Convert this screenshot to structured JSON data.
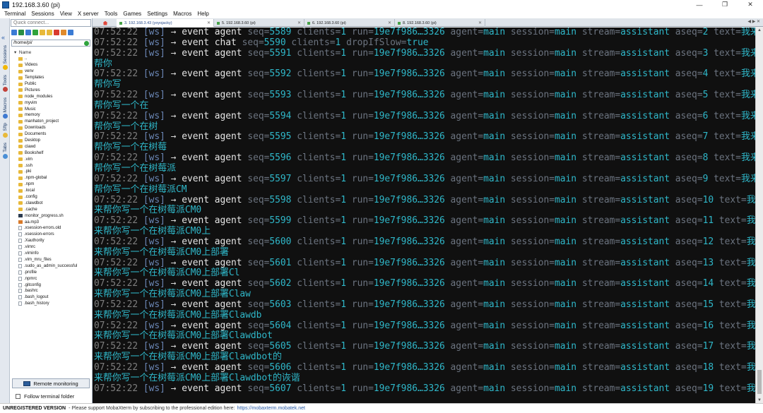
{
  "window": {
    "title": "192.168.3.60 (pi)",
    "controls": {
      "minimize": "—",
      "restore": "❐",
      "close": "✕"
    }
  },
  "menu": [
    "Terminal",
    "Sessions",
    "View",
    "X server",
    "Tools",
    "Games",
    "Settings",
    "Macros",
    "Help"
  ],
  "sidebar": {
    "collapse": "«",
    "tabs": [
      "Sessions",
      "Tools",
      "Macros",
      "Sftp",
      "Tabs"
    ]
  },
  "file_panel": {
    "quick_connect_placeholder": "Quick connect...",
    "path": "/home/pi/",
    "column_header": "Name",
    "files": [
      {
        "name": "..",
        "type": "updir"
      },
      {
        "name": "Videos",
        "type": "folder"
      },
      {
        "name": "venv",
        "type": "folder"
      },
      {
        "name": "Templates",
        "type": "folder"
      },
      {
        "name": "Public",
        "type": "folder"
      },
      {
        "name": "Pictures",
        "type": "folder"
      },
      {
        "name": "node_modules",
        "type": "folder"
      },
      {
        "name": "myvim",
        "type": "folder"
      },
      {
        "name": "Music",
        "type": "folder"
      },
      {
        "name": "memory",
        "type": "folder"
      },
      {
        "name": "manhaton_project",
        "type": "folder"
      },
      {
        "name": "Downloads",
        "type": "folder"
      },
      {
        "name": "Documents",
        "type": "folder"
      },
      {
        "name": "Desktop",
        "type": "folder"
      },
      {
        "name": "clawd",
        "type": "folder"
      },
      {
        "name": "Bookshelf",
        "type": "folder"
      },
      {
        "name": ".vim",
        "type": "folder"
      },
      {
        "name": ".ssh",
        "type": "folder"
      },
      {
        "name": ".pki",
        "type": "folder"
      },
      {
        "name": ".npm-global",
        "type": "folder"
      },
      {
        "name": ".npm",
        "type": "folder"
      },
      {
        "name": ".local",
        "type": "folder"
      },
      {
        "name": ".config",
        "type": "folder"
      },
      {
        "name": ".clawdbot",
        "type": "folder"
      },
      {
        "name": ".cache",
        "type": "folder"
      },
      {
        "name": "monitor_progress.sh",
        "type": "sh"
      },
      {
        "name": "aa.mp3",
        "type": "media"
      },
      {
        "name": ".xsession-errors.old",
        "type": "file"
      },
      {
        "name": ".xsession-errors",
        "type": "file"
      },
      {
        "name": ".Xauthority",
        "type": "file"
      },
      {
        "name": ".vimrc",
        "type": "file"
      },
      {
        "name": ".viminfo",
        "type": "file"
      },
      {
        "name": ".vim_mru_files",
        "type": "file"
      },
      {
        "name": ".sudo_as_admin_successful",
        "type": "file"
      },
      {
        "name": ".profile",
        "type": "file"
      },
      {
        "name": ".npmrc",
        "type": "file"
      },
      {
        "name": ".gitconfig",
        "type": "file"
      },
      {
        "name": ".bashrc",
        "type": "file"
      },
      {
        "name": ".bash_logout",
        "type": "file"
      },
      {
        "name": ".bash_history",
        "type": "file"
      }
    ],
    "remote_monitoring": "Remote monitoring",
    "follow_terminal": "Follow terminal folder"
  },
  "tabs": [
    {
      "label": "3. 192.168.3.43 (yoyojacky)",
      "active": true
    },
    {
      "label": "5. 192.168.3.60 (pi)",
      "active": false
    },
    {
      "label": "6. 192.168.3.60 (pi)",
      "active": false
    },
    {
      "label": "8. 192.168.3.60 (pi)",
      "active": false
    }
  ],
  "tab_close": "✕",
  "tab_nav": "◀ ▶ ✕",
  "terminal": {
    "lines": [
      {
        "time": "07:52:22",
        "src": "[ws]",
        "arrow": "→",
        "ev": "event agent",
        "seq": "5589",
        "clients": "1",
        "run": "19e7f986…3326",
        "agent": "main",
        "session": "main",
        "stream": "assistant",
        "aseq": "2",
        "text": "我来"
      },
      {
        "time": "07:52:22",
        "src": "[ws]",
        "arrow": "→",
        "ev": "event chat",
        "seq": "5590",
        "clients": "1",
        "tail": "dropIfSlow",
        "tailval": "true"
      },
      {
        "time": "07:52:22",
        "src": "[ws]",
        "arrow": "→",
        "ev": "event agent",
        "seq": "5591",
        "clients": "1",
        "run": "19e7f986…3326",
        "agent": "main",
        "session": "main",
        "stream": "assistant",
        "aseq": "3",
        "text": "我来",
        "cont": "帮你"
      },
      {
        "time": "07:52:22",
        "src": "[ws]",
        "arrow": "→",
        "ev": "event agent",
        "seq": "5592",
        "clients": "1",
        "run": "19e7f986…3326",
        "agent": "main",
        "session": "main",
        "stream": "assistant",
        "aseq": "4",
        "text": "我来",
        "cont": "帮你写"
      },
      {
        "time": "07:52:22",
        "src": "[ws]",
        "arrow": "→",
        "ev": "event agent",
        "seq": "5593",
        "clients": "1",
        "run": "19e7f986…3326",
        "agent": "main",
        "session": "main",
        "stream": "assistant",
        "aseq": "5",
        "text": "我来",
        "cont": "帮你写一个在"
      },
      {
        "time": "07:52:22",
        "src": "[ws]",
        "arrow": "→",
        "ev": "event agent",
        "seq": "5594",
        "clients": "1",
        "run": "19e7f986…3326",
        "agent": "main",
        "session": "main",
        "stream": "assistant",
        "aseq": "6",
        "text": "我来",
        "cont": "帮你写一个在树"
      },
      {
        "time": "07:52:22",
        "src": "[ws]",
        "arrow": "→",
        "ev": "event agent",
        "seq": "5595",
        "clients": "1",
        "run": "19e7f986…3326",
        "agent": "main",
        "session": "main",
        "stream": "assistant",
        "aseq": "7",
        "text": "我来",
        "cont": "帮你写一个在树莓"
      },
      {
        "time": "07:52:22",
        "src": "[ws]",
        "arrow": "→",
        "ev": "event agent",
        "seq": "5596",
        "clients": "1",
        "run": "19e7f986…3326",
        "agent": "main",
        "session": "main",
        "stream": "assistant",
        "aseq": "8",
        "text": "我来",
        "cont": "帮你写一个在树莓派"
      },
      {
        "time": "07:52:22",
        "src": "[ws]",
        "arrow": "→",
        "ev": "event agent",
        "seq": "5597",
        "clients": "1",
        "run": "19e7f986…3326",
        "agent": "main",
        "session": "main",
        "stream": "assistant",
        "aseq": "9",
        "text": "我来",
        "cont": "帮你写一个在树莓派CM"
      },
      {
        "time": "07:52:22",
        "src": "[ws]",
        "arrow": "→",
        "ev": "event agent",
        "seq": "5598",
        "clients": "1",
        "run": "19e7f986…3326",
        "agent": "main",
        "session": "main",
        "stream": "assistant",
        "aseq": "10",
        "text": "我",
        "cont": "来帮你写一个在树莓派CM0"
      },
      {
        "time": "07:52:22",
        "src": "[ws]",
        "arrow": "→",
        "ev": "event agent",
        "seq": "5599",
        "clients": "1",
        "run": "19e7f986…3326",
        "agent": "main",
        "session": "main",
        "stream": "assistant",
        "aseq": "11",
        "text": "我",
        "cont": "来帮你写一个在树莓派CM0上"
      },
      {
        "time": "07:52:22",
        "src": "[ws]",
        "arrow": "→",
        "ev": "event agent",
        "seq": "5600",
        "clients": "1",
        "run": "19e7f986…3326",
        "agent": "main",
        "session": "main",
        "stream": "assistant",
        "aseq": "12",
        "text": "我",
        "cont": "来帮你写一个在树莓派CM0上部署"
      },
      {
        "time": "07:52:22",
        "src": "[ws]",
        "arrow": "→",
        "ev": "event agent",
        "seq": "5601",
        "clients": "1",
        "run": "19e7f986…3326",
        "agent": "main",
        "session": "main",
        "stream": "assistant",
        "aseq": "13",
        "text": "我",
        "cont": "来帮你写一个在树莓派CM0上部署Cl"
      },
      {
        "time": "07:52:22",
        "src": "[ws]",
        "arrow": "→",
        "ev": "event agent",
        "seq": "5602",
        "clients": "1",
        "run": "19e7f986…3326",
        "agent": "main",
        "session": "main",
        "stream": "assistant",
        "aseq": "14",
        "text": "我",
        "cont": "来帮你写一个在树莓派CM0上部署Claw"
      },
      {
        "time": "07:52:22",
        "src": "[ws]",
        "arrow": "→",
        "ev": "event agent",
        "seq": "5603",
        "clients": "1",
        "run": "19e7f986…3326",
        "agent": "main",
        "session": "main",
        "stream": "assistant",
        "aseq": "15",
        "text": "我",
        "cont": "来帮你写一个在树莓派CM0上部署Clawdb"
      },
      {
        "time": "07:52:22",
        "src": "[ws]",
        "arrow": "→",
        "ev": "event agent",
        "seq": "5604",
        "clients": "1",
        "run": "19e7f986…3326",
        "agent": "main",
        "session": "main",
        "stream": "assistant",
        "aseq": "16",
        "text": "我",
        "cont": "来帮你写一个在树莓派CM0上部署Clawdbot"
      },
      {
        "time": "07:52:22",
        "src": "[ws]",
        "arrow": "→",
        "ev": "event agent",
        "seq": "5605",
        "clients": "1",
        "run": "19e7f986…3326",
        "agent": "main",
        "session": "main",
        "stream": "assistant",
        "aseq": "17",
        "text": "我",
        "cont": "来帮你写一个在树莓派CM0上部署Clawdbot的"
      },
      {
        "time": "07:52:22",
        "src": "[ws]",
        "arrow": "→",
        "ev": "event agent",
        "seq": "5606",
        "clients": "1",
        "run": "19e7f986…3326",
        "agent": "main",
        "session": "main",
        "stream": "assistant",
        "aseq": "18",
        "text": "我",
        "cont": "来帮你写一个在树莓派CM0上部署Clawdbot的诙谐"
      },
      {
        "time": "07:52:22",
        "src": "[ws]",
        "arrow": "→",
        "ev": "event agent",
        "seq": "5607",
        "clients": "1",
        "run": "19e7f986…3326",
        "agent": "main",
        "session": "main",
        "stream": "assistant",
        "aseq": "19",
        "text": "我"
      }
    ]
  },
  "status_bar": {
    "registration": "UNREGISTERED VERSION",
    "message": "-  Please support MobaXterm by subscribing to the professional edition here:",
    "link": "https://mobaxterm.mobatek.net"
  }
}
